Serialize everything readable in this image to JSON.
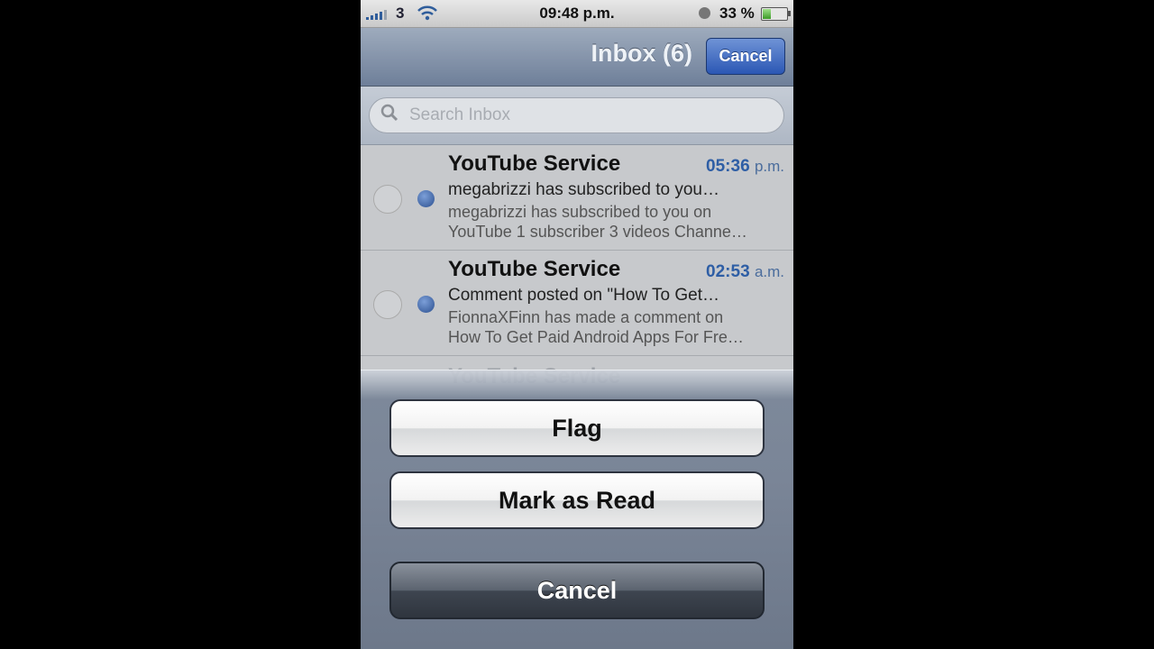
{
  "status_bar": {
    "carrier": "3",
    "time": "09:48 p.m.",
    "battery_percent": "33 %",
    "battery_level": 0.33,
    "icons": [
      "signal-icon",
      "wifi-icon",
      "orientation-lock-icon",
      "battery-icon"
    ]
  },
  "nav": {
    "title": "Inbox (6)",
    "cancel_label": "Cancel"
  },
  "search": {
    "placeholder": "Search Inbox"
  },
  "messages": [
    {
      "sender": "YouTube Service",
      "time": "05:36",
      "time_suffix": "p.m.",
      "subject": "megabrizzi has subscribed to you…",
      "preview_line1": "megabrizzi has subscribed to you on",
      "preview_line2": "YouTube 1 subscriber 3 videos Channe…",
      "unread": true
    },
    {
      "sender": "YouTube Service",
      "time": "02:53",
      "time_suffix": "a.m.",
      "subject": "Comment posted on \"How To Get…",
      "preview_line1": "FionnaXFinn has made a comment on",
      "preview_line2": "How To Get Paid Android Apps For Fre…",
      "unread": true
    },
    {
      "sender": "YouTube Service"
    }
  ],
  "action_sheet": {
    "flag_label": "Flag",
    "mark_read_label": "Mark as Read",
    "cancel_label": "Cancel"
  },
  "colors": {
    "accent_blue": "#2b57b4",
    "unread_dot": "#2b4f8f",
    "time_blue": "#2e5ea5"
  }
}
